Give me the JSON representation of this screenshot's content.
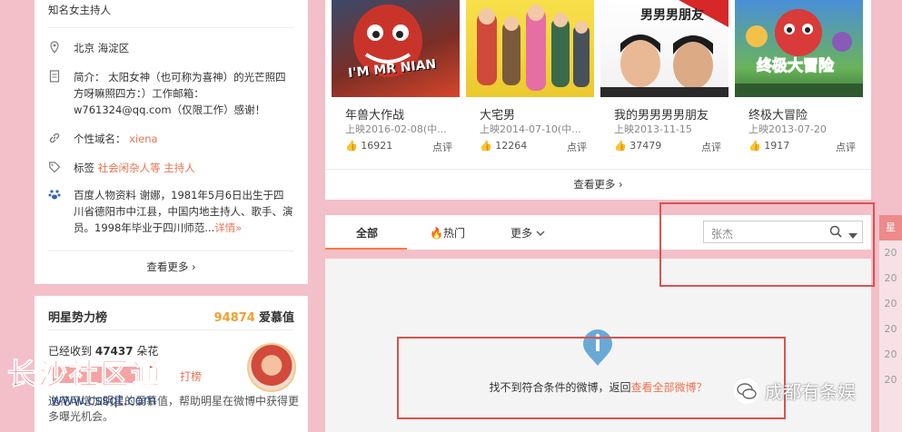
{
  "profile": {
    "intro_top": "知名女主持人",
    "location": "北京 海淀区",
    "bio": "简介： 太阳女神（也可称为喜神）的光芒照四方呀嘛照四方：）工作邮箱：w761324@qq.com（仅限工作）感谢！",
    "domain_label": "个性域名：",
    "domain_value": "xiena",
    "tags_label": "标签",
    "tags_value": "社会闲杂人等 主持人",
    "baike": "百度人物资料 谢娜，1981年5月6日出生于四川省德阳市中江县，中国内地主持人、歌手、演员。1998年毕业于四川师范...",
    "baike_more": "详情»",
    "view_more": "查看更多 ›"
  },
  "rank": {
    "title": "明星势力榜",
    "score": "94874",
    "score_label": "爱慕值",
    "received": "已经收到",
    "flowers_count": "47437",
    "flowers_unit": "朵花",
    "hit_list": "打榜",
    "desc": "送花可增加明星的爱慕值，帮助明星在微博中获得更多曝光机会。"
  },
  "movies": [
    {
      "title": "年兽大作战",
      "date": "上映2016-02-08(中...",
      "likes": "16921",
      "review": "点评",
      "poster_text": "I'M MR NIAN"
    },
    {
      "title": "大宅男",
      "date": "上映2014-07-10(中...",
      "likes": "12264",
      "review": "点评",
      "poster_text": ""
    },
    {
      "title": "我的男男男男朋友",
      "date": "上映2013-11-15",
      "likes": "37479",
      "review": "点评",
      "poster_text": "男男男朋友"
    },
    {
      "title": "终极大冒险",
      "date": "上映2013-07-20",
      "likes": "1917",
      "review": "点评",
      "poster_text": "终极大冒险"
    }
  ],
  "movies_more": "查看更多 ›",
  "tabs": {
    "all": "全部",
    "hot": "热门",
    "more": "更多"
  },
  "search": {
    "value": "张杰"
  },
  "empty": {
    "text": "找不到符合条件的微博，返回",
    "link": "查看全部微博？"
  },
  "watermarks": {
    "left_title": "长沙社区通",
    "left_url": "www.cssqt.com",
    "right": "成都有条娱"
  },
  "side_strip": {
    "top": "星",
    "years": [
      "20",
      "20",
      "20",
      "20",
      "20",
      "20"
    ]
  }
}
